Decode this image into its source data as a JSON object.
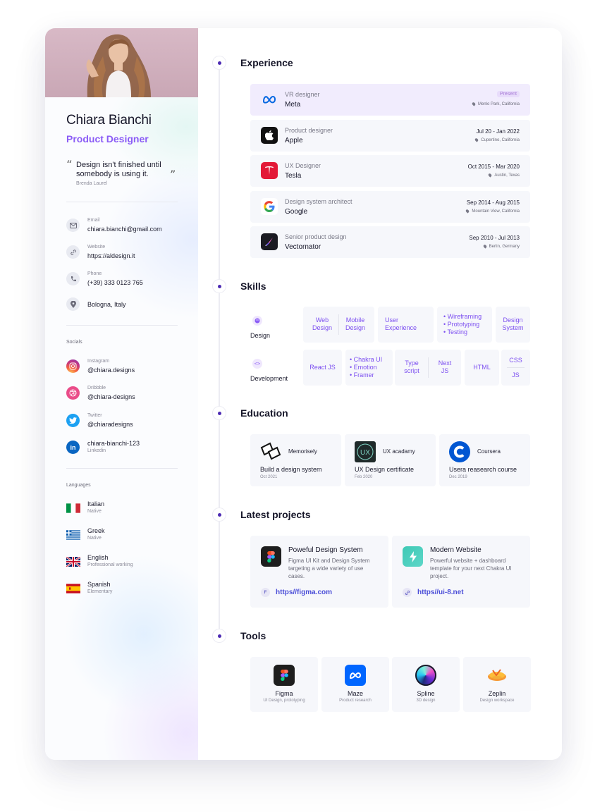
{
  "profile": {
    "name": "Chiara Bianchi",
    "role": "Product Designer",
    "quote": "Design isn't finished until somebody is using it.",
    "quote_author": "Brenda Laurel"
  },
  "contact": [
    {
      "label": "Email",
      "value": "chiara.bianchi@gmail.com",
      "icon": "mail-icon"
    },
    {
      "label": "Website",
      "value": "https://aldesign.it",
      "icon": "link-icon"
    },
    {
      "label": "Phone",
      "value": "(+39) 333 0123 765",
      "icon": "phone-icon"
    },
    {
      "label": "",
      "value": "Bologna, Italy",
      "icon": "location-icon"
    }
  ],
  "socials": {
    "title": "Socials",
    "items": [
      {
        "label": "Instagram",
        "value": "@chiara.designs",
        "icon": "instagram-icon",
        "color": "#e1306c"
      },
      {
        "label": "Dribbble",
        "value": "@chiara-designs",
        "icon": "dribbble-icon",
        "color": "#ea4c89"
      },
      {
        "label": "Twitter",
        "value": "@chiaradesigns",
        "icon": "twitter-icon",
        "color": "#1da1f2"
      },
      {
        "label": "chiara-bianchi-123",
        "value": "Linkedin",
        "icon": "linkedin-icon",
        "color": "#0a66c2"
      }
    ]
  },
  "languages": {
    "title": "Languages",
    "items": [
      {
        "name": "Italian",
        "level": "Native"
      },
      {
        "name": "Greek",
        "level": "Native"
      },
      {
        "name": "English",
        "level": "Professional working"
      },
      {
        "name": "Spanish",
        "level": "Elementary"
      }
    ]
  },
  "experience": {
    "title": "Experience",
    "items": [
      {
        "role": "VR designer",
        "company": "Meta",
        "date": "Present",
        "location": "Menlo Park, California"
      },
      {
        "role": "Product designer",
        "company": "Apple",
        "date": "Jul 20 - Jan 2022",
        "location": "Cupertino, California"
      },
      {
        "role": "UX Designer",
        "company": "Tesla",
        "date": "Oct 2015 - Mar 2020",
        "location": "Austin, Texas"
      },
      {
        "role": "Design system architect",
        "company": "Google",
        "date": "Sep 2014 - Aug 2015",
        "location": "Mountain View, California"
      },
      {
        "role": "Senior product design",
        "company": "Vectornator",
        "date": "Sep 2010 - Jul 2013",
        "location": "Berlin, Germany"
      }
    ]
  },
  "skills": {
    "title": "Skills",
    "design_label": "Design",
    "development_label": "Development",
    "design": {
      "web_design": "Web Design",
      "mobile_design": "Mobile Design",
      "user_experience": "User Experience",
      "wireframing": "Wireframing",
      "prototyping": "Prototyping",
      "testing": "Testing",
      "design_system": "Design System"
    },
    "development": {
      "react_js": "React JS",
      "chakra_ui": "Chakra UI",
      "emotion": "Emotion",
      "framer": "Framer",
      "typescript": "Type script",
      "next_js": "Next JS",
      "html": "HTML",
      "css": "CSS",
      "js": "JS"
    }
  },
  "education": {
    "title": "Education",
    "items": [
      {
        "org": "Memorisely",
        "title": "Build a design system",
        "date": "Oct 2021"
      },
      {
        "org": "UX acadamy",
        "title": "UX Design certificate",
        "date": "Feb 2020"
      },
      {
        "org": "Coursera",
        "title": "Usera reasearch course",
        "date": "Dec 2019"
      }
    ]
  },
  "projects": {
    "title": "Latest projects",
    "items": [
      {
        "title": "Poweful Design System",
        "desc": "Figma UI Kit and Design System targeting a wide variety of use cases.",
        "link": "https//figma.com"
      },
      {
        "title": "Modern Website",
        "desc": "Powerful website + dashboard template for your next Chakra UI project.",
        "link": "https//ui-8.net"
      }
    ]
  },
  "tools": {
    "title": "Tools",
    "items": [
      {
        "name": "Figma",
        "sub": "UI Design, prototyping"
      },
      {
        "name": "Maze",
        "sub": "Product research"
      },
      {
        "name": "Spline",
        "sub": "3D design"
      },
      {
        "name": "Zeplin",
        "sub": "Design workspace"
      }
    ]
  },
  "colors": {
    "accent": "#8b5cf6",
    "timeline_dot": "#4c2ab3",
    "link": "#4c4fd8"
  }
}
